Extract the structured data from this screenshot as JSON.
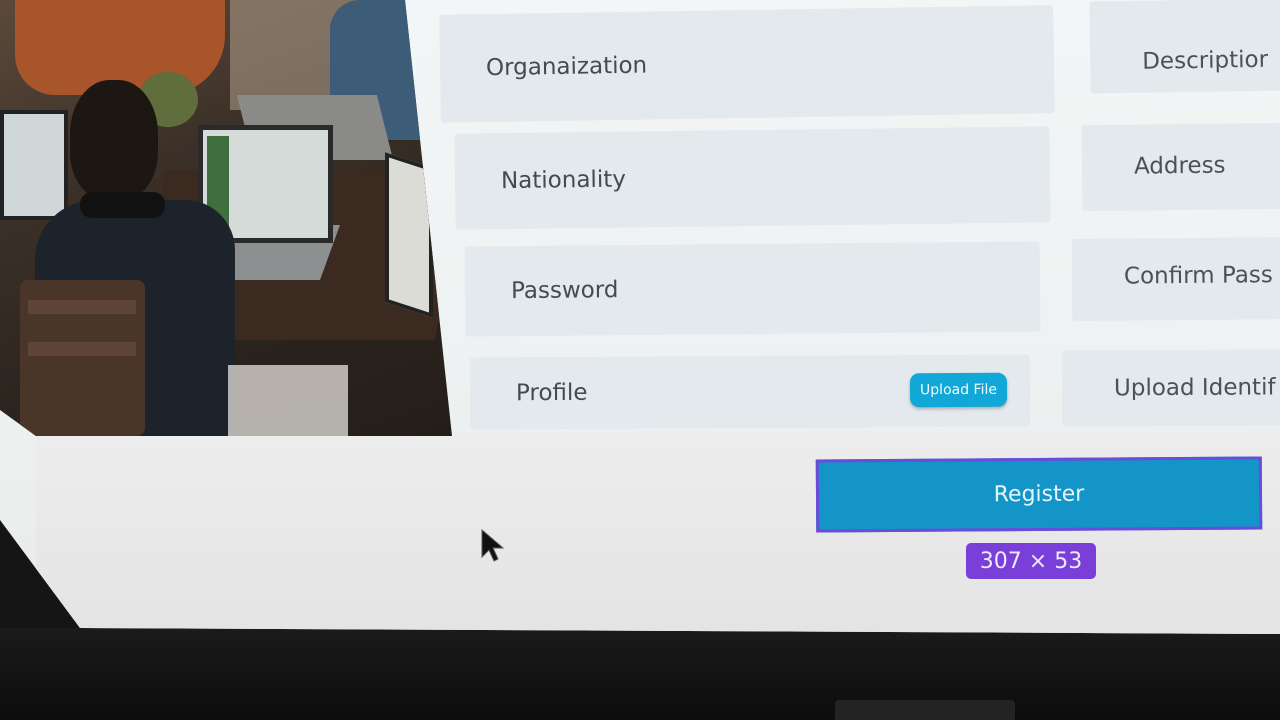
{
  "form": {
    "left_fields": [
      {
        "label": "Organaization"
      },
      {
        "label": "Nationality"
      },
      {
        "label": "Password"
      },
      {
        "label": "Profile"
      }
    ],
    "right_fields": [
      {
        "label": "Descriptior"
      },
      {
        "label": "Address"
      },
      {
        "label": "Confirm Pass"
      },
      {
        "label": "Upload Identif"
      }
    ],
    "upload_label": "Upload File",
    "register_label": "Register"
  },
  "dev_overlay": {
    "size_badge": "307 × 53"
  },
  "colors": {
    "field_bg": "#e3e9ed",
    "accent_blue": "#1495c8",
    "upload_blue": "#11a7d6",
    "badge_purple": "#7a3fd8",
    "selection_outline": "#6a4cdb"
  },
  "icons": {
    "cursor": "arrow-cursor-icon"
  }
}
